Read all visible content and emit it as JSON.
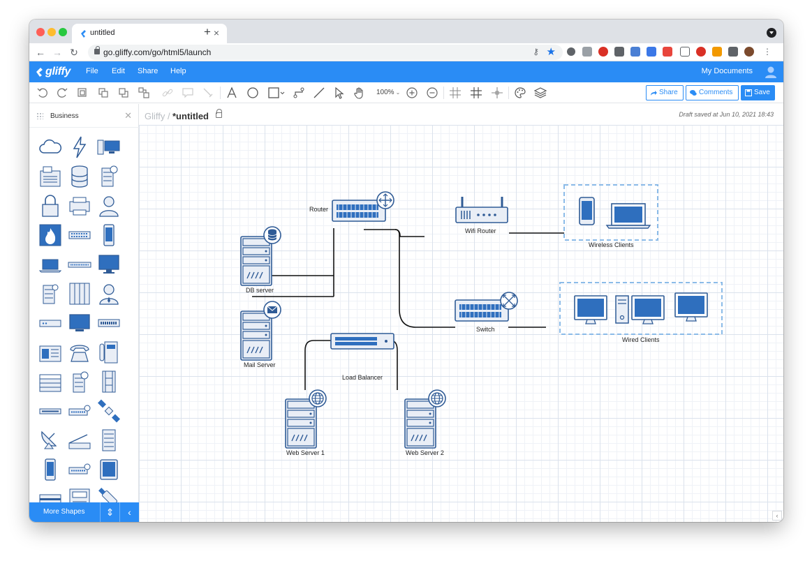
{
  "browser": {
    "tab_title": "untitled",
    "url": "go.gliffy.com/go/html5/launch"
  },
  "app": {
    "logo": "gliffy",
    "menu": [
      "File",
      "Edit",
      "Share",
      "Help"
    ],
    "my_documents": "My Documents",
    "accent_color": "#2a8cf5"
  },
  "toolbar": {
    "zoom": "100%",
    "share": "Share",
    "comments": "Comments",
    "save": "Save"
  },
  "sidebar": {
    "library": "Business",
    "more_shapes": "More Shapes"
  },
  "document": {
    "breadcrumb": "Gliffy /",
    "title": "*untitled",
    "status": "Draft saved at Jun 10, 2021 18:43"
  },
  "diagram": {
    "nodes": {
      "router": "Router",
      "wifi_router": "Wifi Router",
      "wireless_clients": "Wireless Clients",
      "db_server": "DB server",
      "mail_server": "Mail Server",
      "switch": "Switch",
      "wired_clients": "Wired Clients",
      "load_balancer": "Load Balancer",
      "web_server_1": "Web Server 1",
      "web_server_2": "Web Server 2"
    }
  }
}
